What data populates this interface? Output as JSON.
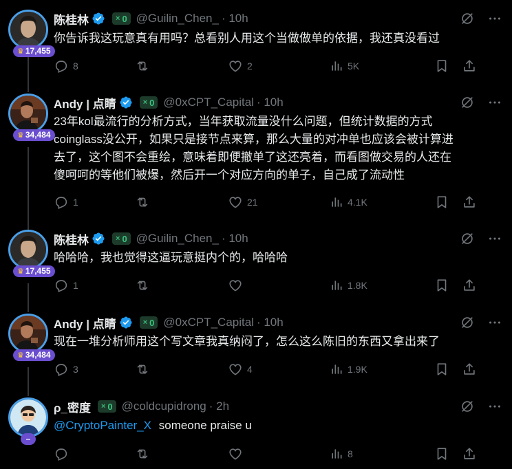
{
  "tweets": [
    {
      "name": "陈桂林",
      "score": "0",
      "handle": "@Guilin_Chen_",
      "time": "· 10h",
      "badge": "17,455",
      "text": "你告诉我这玩意真有用吗？总看别人用这个当做做单的依据，我还真没看过",
      "replies": "8",
      "retweets": "",
      "likes": "2",
      "views": "5K"
    },
    {
      "name": "Andy | 点睛",
      "score": "0",
      "handle": "@0xCPT_Capital",
      "time": "· 10h",
      "badge": "34,484",
      "text_lines": [
        "23年kol最流行的分析方式，当年获取流量没什么问题，但统计数据的方式",
        "coinglass没公开，如果只是接节点来算，那么大量的对冲单也应该会被计算进",
        "去了，这个图不会重绘，意味着即便撤单了这还亮着，而看图做交易的人还在",
        "傻呵呵的等他们被爆，然后开一个对应方向的单子，自己成了流动性"
      ],
      "replies": "1",
      "retweets": "",
      "likes": "21",
      "views": "4.1K"
    },
    {
      "name": "陈桂林",
      "score": "0",
      "handle": "@Guilin_Chen_",
      "time": "· 10h",
      "badge": "17,455",
      "text": "哈哈哈，我也觉得这逼玩意挺内个的，哈哈哈",
      "replies": "1",
      "retweets": "",
      "likes": "",
      "views": "1.8K"
    },
    {
      "name": "Andy | 点睛",
      "score": "0",
      "handle": "@0xCPT_Capital",
      "time": "· 10h",
      "badge": "34,484",
      "text": "现在一堆分析师用这个写文章我真纳闷了，怎么这么陈旧的东西又拿出来了",
      "replies": "3",
      "retweets": "",
      "likes": "4",
      "views": "1.9K"
    },
    {
      "name": "ρ_密度",
      "score": "0",
      "handle": "@coldcupidrong",
      "time": "· 2h",
      "badge": "–",
      "mention": "@CryptoPainter_X",
      "text": "someone praise u",
      "replies": "",
      "retweets": "",
      "likes": "",
      "views": "8"
    }
  ],
  "colors": {
    "accent": "#1d9bf0",
    "muted": "#71767b",
    "score_green": "#3ac47d",
    "badge_purple": "#6a4ecf",
    "avatar_ring": "#4a9fe8"
  },
  "icons": [
    "verified-icon",
    "grok-icon",
    "more-icon",
    "reply-icon",
    "retweet-icon",
    "like-icon",
    "views-icon",
    "bookmark-icon",
    "share-icon",
    "trophy-icon"
  ]
}
